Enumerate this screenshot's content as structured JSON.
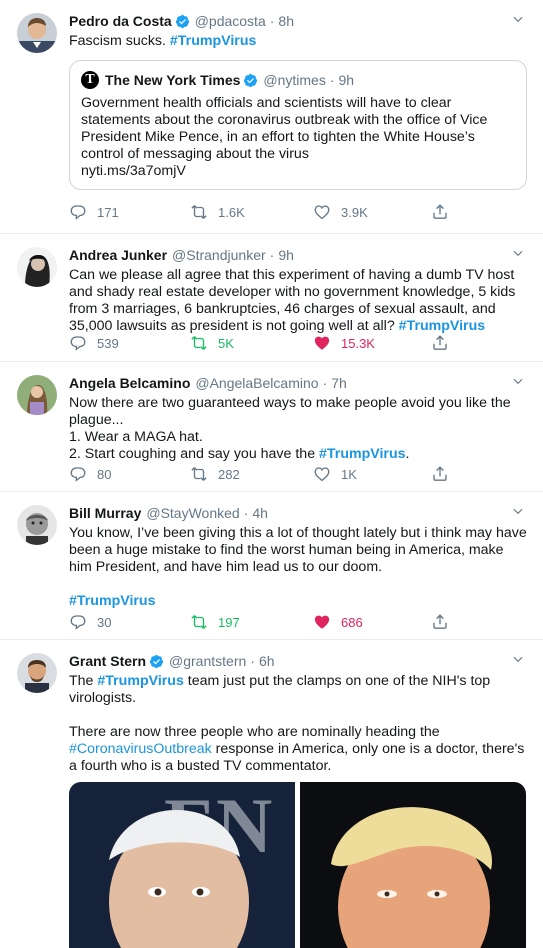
{
  "tweets": [
    {
      "name": "Pedro da Costa",
      "handle": "@pdacosta",
      "sep": "·",
      "time": "8h",
      "verified": true,
      "text_plain": "Fascism sucks. ",
      "hashtag": "#TrumpVirus",
      "quote": {
        "name": "The New York Times",
        "handle": "@nytimes",
        "sep": "·",
        "time": "9h",
        "logo": "T",
        "text": "Government health officials and scientists will have to clear statements about the coronavirus outbreak with the office of Vice President Mike Pence, in an effort to tighten the White House’s control of messaging about the virus",
        "link": "nyti.ms/3a7omjV"
      },
      "replies": "171",
      "retweets": "1.6K",
      "likes": "3.9K"
    },
    {
      "name": "Andrea Junker",
      "handle": "@Strandjunker",
      "sep": "·",
      "time": "9h",
      "text_plain": "Can we please all agree that this experiment of having a dumb TV host and shady real estate developer with no government knowledge, 5 kids from 3 marriages, 6 bankruptcies, 46 charges of sexual assault, and 35,000 lawsuits as president is not going well at all? ",
      "hashtag": "#TrumpVirus",
      "replies": "539",
      "retweets": "5K",
      "likes": "15.3K",
      "retweeted": true,
      "liked": true
    },
    {
      "name": "Angela Belcamino",
      "handle": "@AngelaBelcamino",
      "sep": "·",
      "time": "7h",
      "text_plain": "Now there are two guaranteed ways to make people avoid you like the plague...\n1. Wear a MAGA hat.\n2. Start coughing and say you have the ",
      "hashtag": "#TrumpVirus",
      "text_after": ".",
      "replies": "80",
      "retweets": "282",
      "likes": "1K"
    },
    {
      "name": "Bill Murray",
      "handle": "@StayWonked",
      "sep": "·",
      "time": "4h",
      "text_plain": "You know, I’ve been giving this a lot of thought lately but i think may have been a huge mistake to find the worst human being in America, make him President, and have him lead us to our doom.",
      "hashtag": "#TrumpVirus",
      "replies": "30",
      "retweets": "197",
      "likes": "686",
      "retweeted": true,
      "liked": true
    },
    {
      "name": "Grant Stern",
      "handle": "@grantstern",
      "sep": "·",
      "time": "6h",
      "verified": true,
      "text_pre": "The ",
      "hashtag": "#TrumpVirus",
      "text_mid": " team just put the clamps on one of the NIH's top virologists.",
      "text_p2_pre": "There are now three people who are nominally heading the ",
      "hashtag2": "#CoronavirusOutbreak",
      "text_p2_post": " response in America, only one is a doctor, there's a fourth who is a busted TV commentator."
    }
  ],
  "colors": {
    "link": "#1b95e0",
    "retweet_active": "#17bf63",
    "like_active": "#e0245e",
    "secondary": "#657786",
    "border": "#e6ecf0"
  },
  "icons": [
    "verified-icon",
    "chevron-down-icon",
    "reply-icon",
    "retweet-icon",
    "like-icon",
    "share-icon"
  ]
}
